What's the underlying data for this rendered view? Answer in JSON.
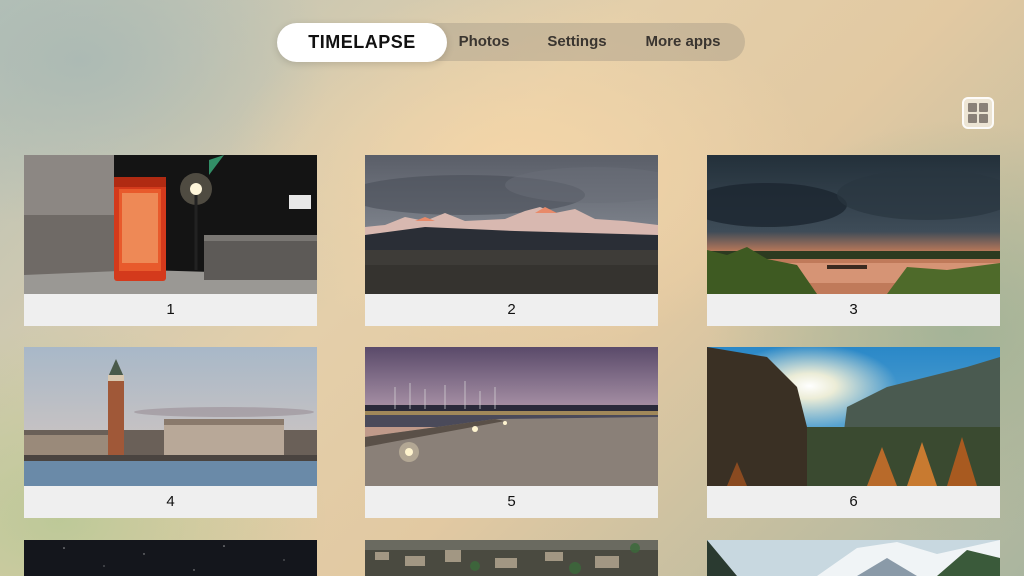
{
  "nav": {
    "tabs": [
      {
        "label": "TIMELAPSE",
        "active": true
      },
      {
        "label": "Photos",
        "active": false
      },
      {
        "label": "Settings",
        "active": false
      },
      {
        "label": "More apps",
        "active": false
      }
    ]
  },
  "view_toggle": {
    "icon": "grid-icon"
  },
  "tiles": [
    {
      "label": "1",
      "scene": "london-phone-booth-night"
    },
    {
      "label": "2",
      "scene": "mountain-range-dusk"
    },
    {
      "label": "3",
      "scene": "lake-sunset-reeds"
    },
    {
      "label": "4",
      "scene": "venice-campanile-waterfront"
    },
    {
      "label": "5",
      "scene": "harbor-pier-night-lights"
    },
    {
      "label": "6",
      "scene": "valley-sunburst-mountains"
    },
    {
      "label": "",
      "scene": "starry-night-sky"
    },
    {
      "label": "",
      "scene": "city-aerial-dusk"
    },
    {
      "label": "",
      "scene": "snowy-mountain-peaks"
    }
  ],
  "colors": {
    "active_tab_bg": "#ffffff",
    "caption_bg": "#efefef",
    "nav_pill_bg": "rgba(150,140,125,0.35)"
  }
}
